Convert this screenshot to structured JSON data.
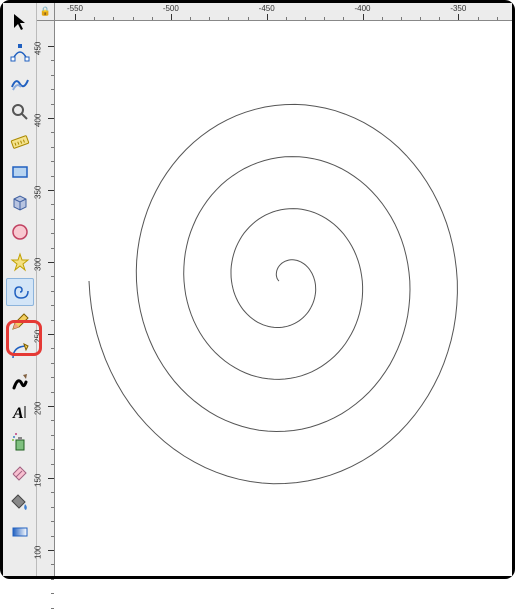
{
  "toolbox": {
    "tools": [
      {
        "id": "selector",
        "name": "selector-tool",
        "selected": false
      },
      {
        "id": "node",
        "name": "node-tool",
        "selected": false
      },
      {
        "id": "tweak",
        "name": "tweak-tool",
        "selected": false
      },
      {
        "id": "zoom",
        "name": "zoom-tool",
        "selected": false
      },
      {
        "id": "measure",
        "name": "measure-tool",
        "selected": false
      },
      {
        "id": "rect",
        "name": "rectangle-tool",
        "selected": false
      },
      {
        "id": "box3d",
        "name": "3dbox-tool",
        "selected": false
      },
      {
        "id": "circle",
        "name": "circle-tool",
        "selected": false
      },
      {
        "id": "star",
        "name": "star-tool",
        "selected": false
      },
      {
        "id": "spiral",
        "name": "spiral-tool",
        "selected": true
      },
      {
        "id": "pencil",
        "name": "pencil-tool",
        "selected": false
      },
      {
        "id": "bezier",
        "name": "bezier-tool",
        "selected": false
      },
      {
        "id": "calligraphy",
        "name": "calligraphy-tool",
        "selected": false
      },
      {
        "id": "text",
        "name": "text-tool",
        "selected": false
      },
      {
        "id": "spray",
        "name": "spray-tool",
        "selected": false
      },
      {
        "id": "eraser",
        "name": "eraser-tool",
        "selected": false
      },
      {
        "id": "fill",
        "name": "fill-tool",
        "selected": false
      },
      {
        "id": "gradient",
        "name": "gradient-tool",
        "selected": false
      }
    ]
  },
  "ruler": {
    "h_labels": [
      "-550",
      "-500",
      "-450",
      "-400",
      "-350"
    ],
    "v_labels": [
      "450",
      "400",
      "350",
      "300",
      "250",
      "200",
      "150",
      "100"
    ]
  },
  "canvas": {
    "spiral_turns": 4
  }
}
